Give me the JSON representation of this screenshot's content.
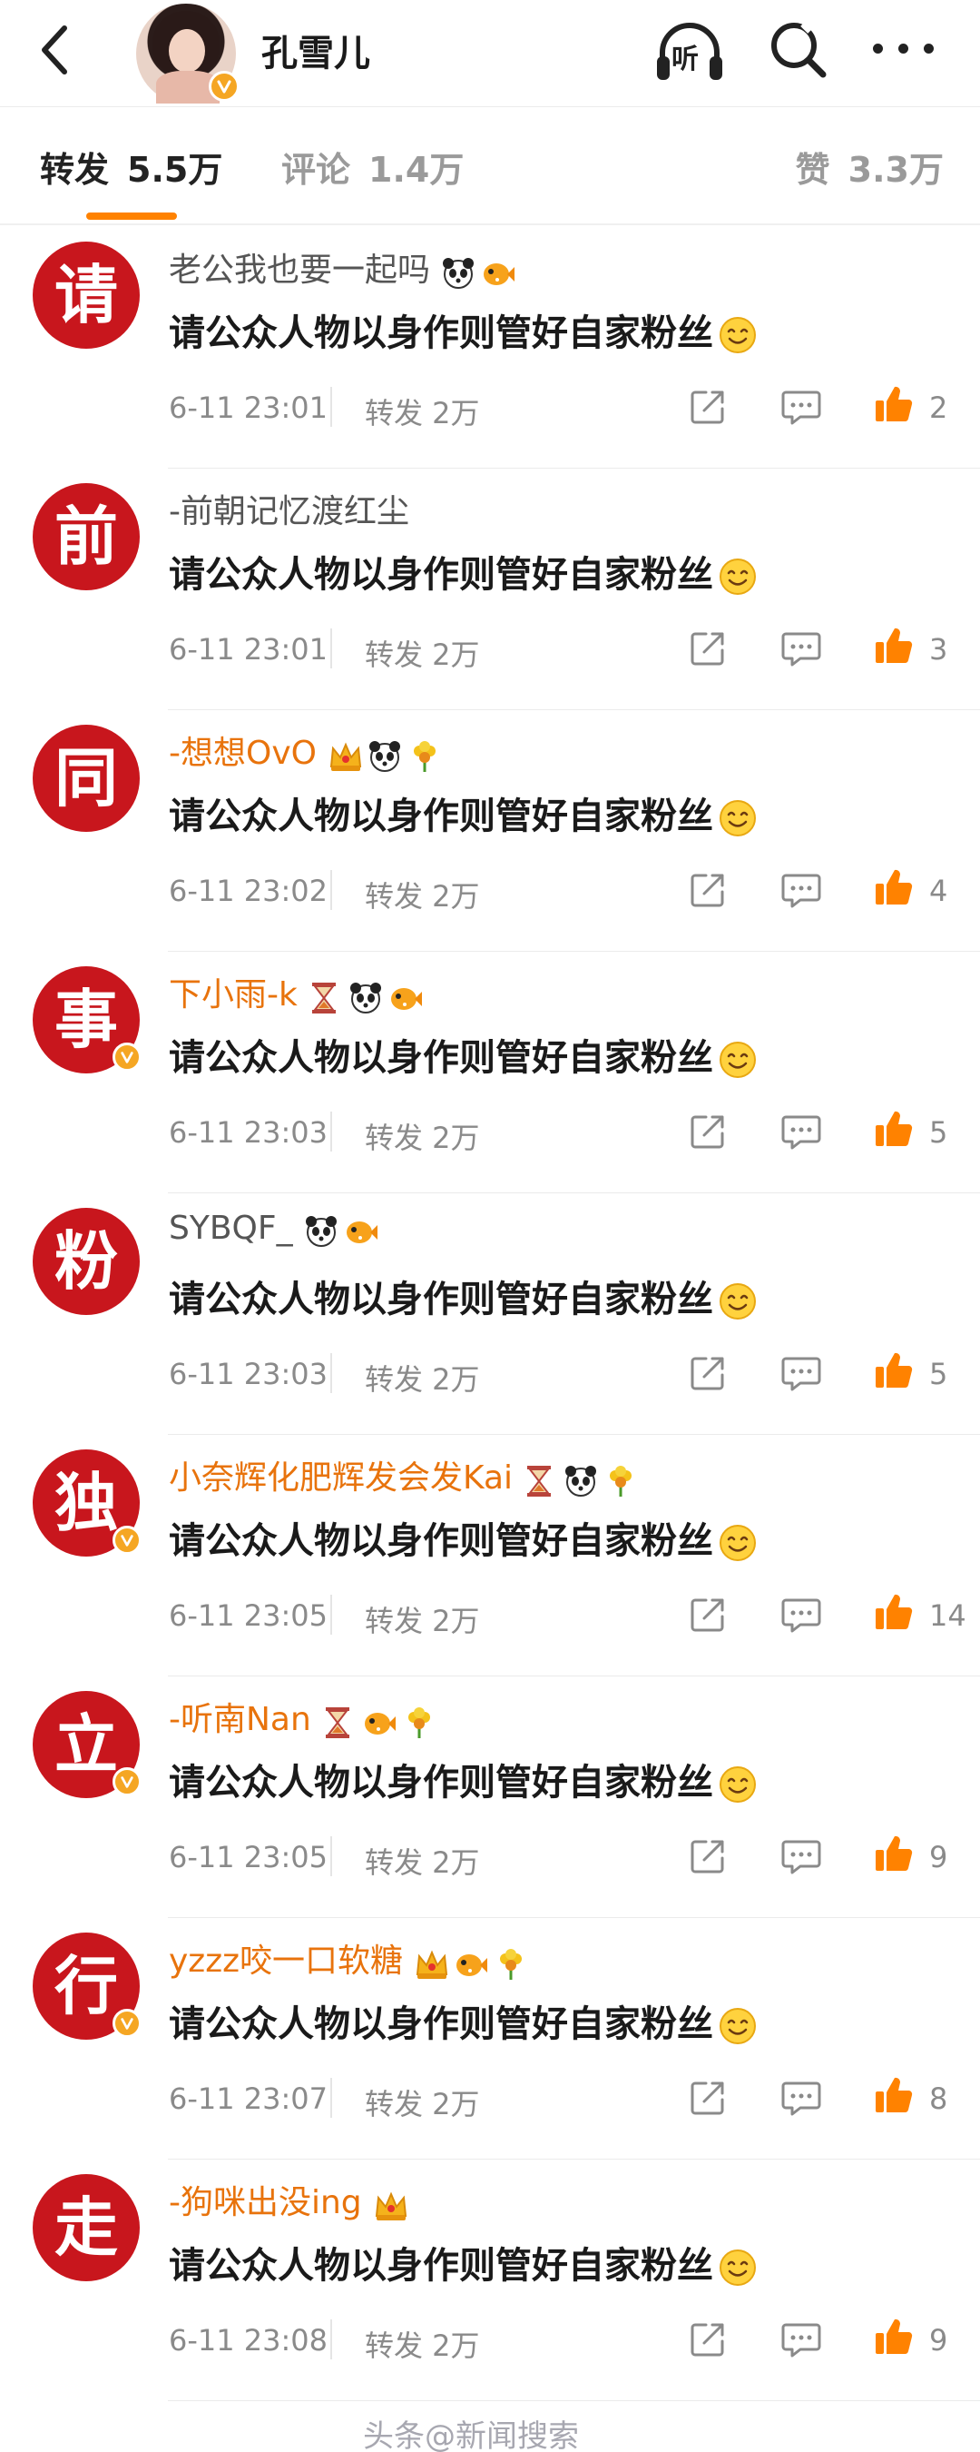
{
  "header": {
    "username": "孔雪儿",
    "listen_label": "听"
  },
  "tabs": [
    {
      "label": "转发",
      "count": "5.5万",
      "active": true
    },
    {
      "label": "评论",
      "count": "1.4万",
      "active": false
    },
    {
      "label": "赞",
      "count": "3.3万",
      "active": false
    }
  ],
  "items": [
    {
      "char": "请",
      "name": "老公我也要一起吗",
      "vip": false,
      "verified": false,
      "badges": [
        "panda-icon",
        "fish-icon"
      ],
      "text": "请公众人物以身作则管好自家粉丝",
      "time": "6-11 23:01",
      "repost": "转发 2万",
      "likes": "2"
    },
    {
      "char": "前",
      "name": "-前朝记忆渡红尘",
      "vip": false,
      "verified": false,
      "badges": [],
      "text": "请公众人物以身作则管好自家粉丝",
      "time": "6-11 23:01",
      "repost": "转发 2万",
      "likes": "3"
    },
    {
      "char": "同",
      "name": "-想想OvO",
      "vip": true,
      "verified": false,
      "badges": [
        "crown-icon",
        "panda-icon",
        "flower-icon"
      ],
      "text": "请公众人物以身作则管好自家粉丝",
      "time": "6-11 23:02",
      "repost": "转发 2万",
      "likes": "4"
    },
    {
      "char": "事",
      "name": "下小雨-k",
      "vip": true,
      "verified": true,
      "badges": [
        "hourglass-icon",
        "panda-icon",
        "fish-icon"
      ],
      "text": "请公众人物以身作则管好自家粉丝",
      "time": "6-11 23:03",
      "repost": "转发 2万",
      "likes": "5"
    },
    {
      "char": "粉",
      "name": "SYBQF_",
      "vip": false,
      "verified": false,
      "badges": [
        "panda-icon",
        "fish-icon"
      ],
      "text": "请公众人物以身作则管好自家粉丝",
      "time": "6-11 23:03",
      "repost": "转发 2万",
      "likes": "5"
    },
    {
      "char": "独",
      "name": "小奈辉化肥辉发会发Kai",
      "vip": true,
      "verified": true,
      "badges": [
        "hourglass-icon",
        "panda-icon",
        "flower-icon"
      ],
      "text": "请公众人物以身作则管好自家粉丝",
      "time": "6-11 23:05",
      "repost": "转发 2万",
      "likes": "14"
    },
    {
      "char": "立",
      "name": "-听南Nan",
      "vip": true,
      "verified": true,
      "badges": [
        "hourglass-icon",
        "fish-icon",
        "flower-icon"
      ],
      "text": "请公众人物以身作则管好自家粉丝",
      "time": "6-11 23:05",
      "repost": "转发 2万",
      "likes": "9"
    },
    {
      "char": "行",
      "name": "yzzz咬一口软糖",
      "vip": true,
      "verified": true,
      "badges": [
        "crown-icon",
        "fish-icon",
        "flower-icon"
      ],
      "text": "请公众人物以身作则管好自家粉丝",
      "time": "6-11 23:07",
      "repost": "转发 2万",
      "likes": "8"
    },
    {
      "char": "走",
      "name": "-狗咪出没ing",
      "vip": true,
      "verified": false,
      "badges": [
        "crown-icon"
      ],
      "text": "请公众人物以身作则管好自家粉丝",
      "time": "6-11 23:08",
      "repost": "转发 2万",
      "likes": "9"
    }
  ],
  "watermark": "头条@新闻搜索",
  "colors": {
    "accent": "#ff8200",
    "avatar_red": "#c8161d",
    "vip_name": "#e8730c",
    "like": "#ff8200"
  }
}
